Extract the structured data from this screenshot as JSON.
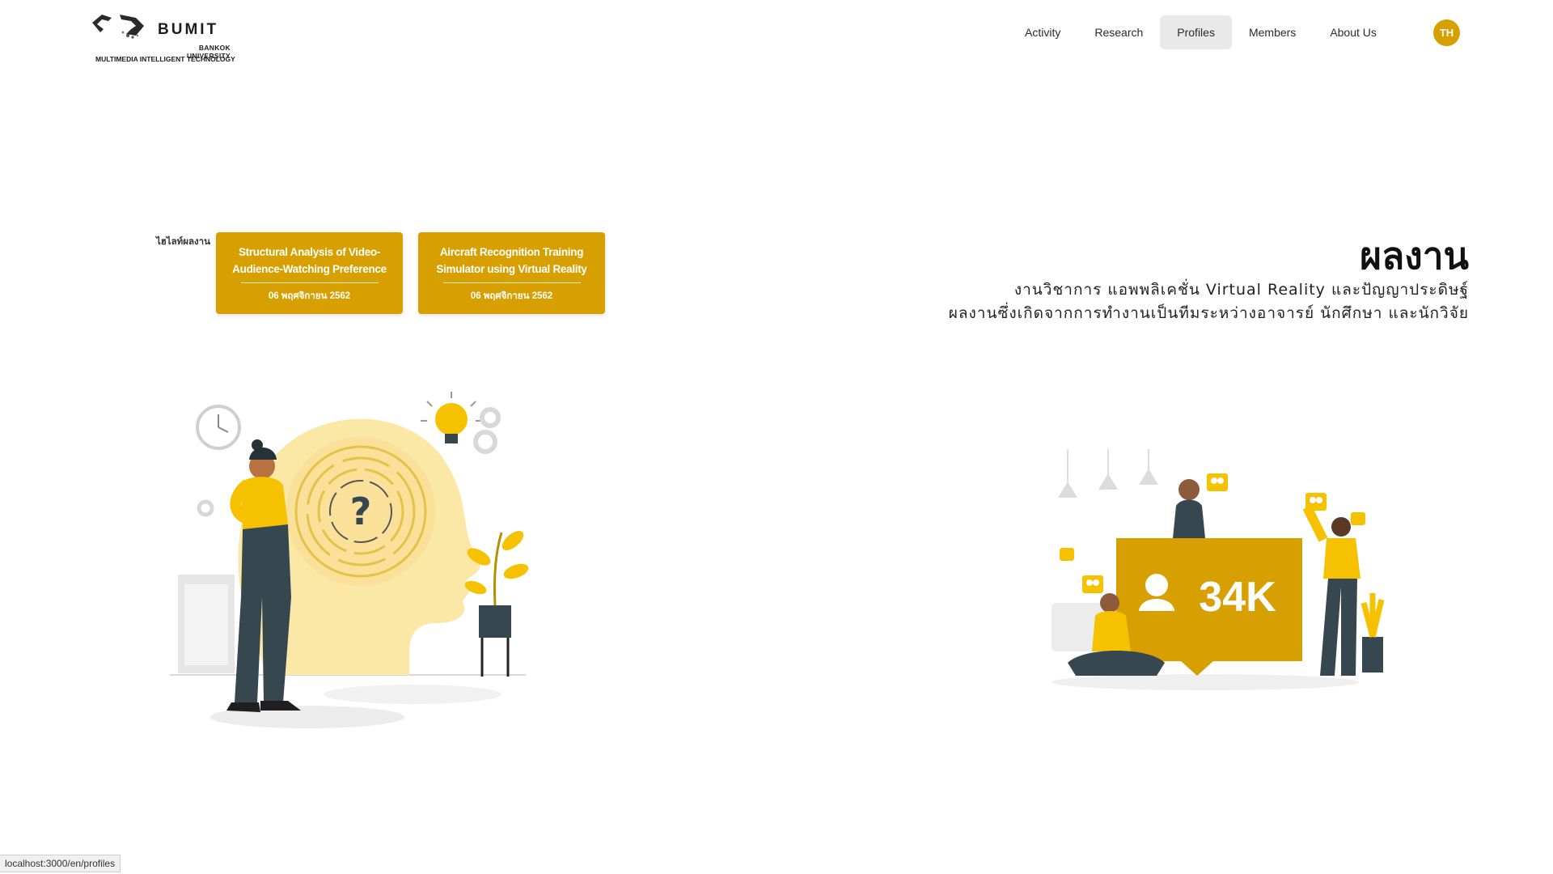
{
  "brand": {
    "name": "BUMIT",
    "line1": "BANKOK UNIVERSITY",
    "line2": "MULTIMEDIA INTELLIGENT TECHNOLOGY"
  },
  "nav": {
    "items": [
      {
        "label": "Activity"
      },
      {
        "label": "Research"
      },
      {
        "label": "Profiles",
        "active": true
      },
      {
        "label": "Members"
      },
      {
        "label": "About Us"
      }
    ],
    "lang": "TH"
  },
  "highlight": {
    "label": "ไฮไลท์ผลงาน",
    "cards": [
      {
        "title": "Structural Analysis of Video-Audience-Watching Preference",
        "date": "06 พฤศจิกายน 2562"
      },
      {
        "title": "Aircraft Recognition Training Simulator using Virtual Reality",
        "date": "06 พฤศจิกายน 2562"
      }
    ]
  },
  "section": {
    "title": "ผลงาน",
    "desc_line1": "งานวิชาการ แอพพลิเคชั่น Virtual Reality และปัญญาประดิษฐ์",
    "desc_line2": "ผลงานซึ่งเกิดจากการทำงานเป็นทีมระหว่างอาจารย์ นักศึกษา และนักวิจัย"
  },
  "illustrations": {
    "left_icon": "thinking-woman-maze-head-illustration",
    "right_icon": "social-media-34k-followers-illustration",
    "right_badge": "34K",
    "left_symbol": "?"
  },
  "status": {
    "url": "localhost:3000/en/profiles"
  },
  "colors": {
    "accent": "#d7a000",
    "accent_light": "#f9e79f",
    "dark": "#37474f",
    "nav_active_bg": "#e9e9e9"
  }
}
